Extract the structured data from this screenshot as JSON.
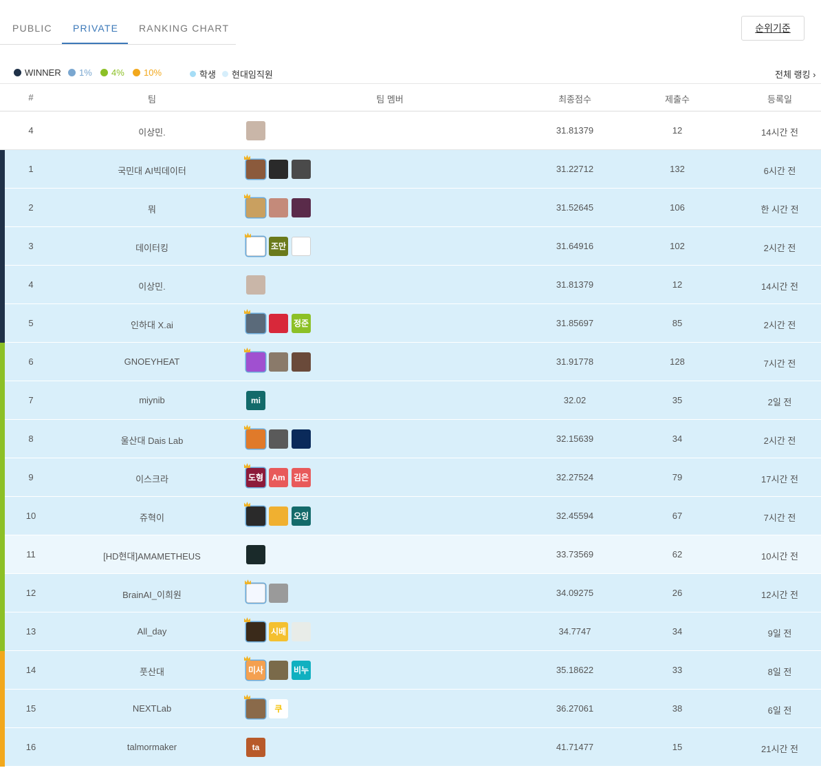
{
  "tabs": [
    {
      "label": "PUBLIC",
      "active": false
    },
    {
      "label": "PRIVATE",
      "active": true
    },
    {
      "label": "RANKING CHART",
      "active": false
    }
  ],
  "sort_button": "순위기준",
  "legend": [
    {
      "label": "WINNER",
      "color": "#1f3148"
    },
    {
      "label": "1%",
      "color": "#7aa7d0"
    },
    {
      "label": "4%",
      "color": "#8cc026"
    },
    {
      "label": "10%",
      "color": "#f2a81d"
    },
    {
      "label": "학생",
      "color": "#a6ddf6"
    },
    {
      "label": "현대임직원",
      "color": "#d6eefb"
    }
  ],
  "full_ranking_link": "전체 랭킹 ›",
  "columns": [
    "#",
    "팀",
    "팀 멤버",
    "최종점수",
    "제출수",
    "등록일"
  ],
  "rows": [
    {
      "rank": "4",
      "team": "이상민.",
      "score": "31.81379",
      "submissions": "12",
      "date": "14시간 전",
      "style": "white",
      "bar": "",
      "members": [
        {
          "type": "photo",
          "color": "#c9b6a8"
        }
      ]
    },
    {
      "rank": "1",
      "team": "국민대 AI빅데이터",
      "score": "31.22712",
      "submissions": "132",
      "date": "6시간 전",
      "style": "blue",
      "bar": "#1f3148",
      "members": [
        {
          "type": "photo",
          "color": "#8b5a3c",
          "leader": true
        },
        {
          "type": "photo",
          "color": "#2a2a2a"
        },
        {
          "type": "photo",
          "color": "#4a4a4a"
        }
      ]
    },
    {
      "rank": "2",
      "team": "뭐",
      "score": "31.52645",
      "submissions": "106",
      "date": "한 시간 전",
      "style": "blue",
      "bar": "#1f3148",
      "members": [
        {
          "type": "photo",
          "color": "#c9a060",
          "leader": true
        },
        {
          "type": "photo",
          "color": "#c48a7a"
        },
        {
          "type": "photo",
          "color": "#5a2b4a"
        }
      ]
    },
    {
      "rank": "3",
      "team": "데이터킹",
      "score": "31.64916",
      "submissions": "102",
      "date": "2시간 전",
      "style": "blue",
      "bar": "#1f3148",
      "members": [
        {
          "type": "photo",
          "color": "#ffffff",
          "leader": true
        },
        {
          "type": "text",
          "text": "조만",
          "color": "#6b7a1b"
        },
        {
          "type": "photo",
          "color": "#ffffff"
        }
      ]
    },
    {
      "rank": "4",
      "team": "이상민.",
      "score": "31.81379",
      "submissions": "12",
      "date": "14시간 전",
      "style": "blue",
      "bar": "#1f3148",
      "members": [
        {
          "type": "photo",
          "color": "#c9b6a8"
        }
      ]
    },
    {
      "rank": "5",
      "team": "인하대 X.ai",
      "score": "31.85697",
      "submissions": "85",
      "date": "2시간 전",
      "style": "blue",
      "bar": "#1f3148",
      "members": [
        {
          "type": "photo",
          "color": "#5a6a7a",
          "leader": true
        },
        {
          "type": "photo",
          "color": "#d8283a"
        },
        {
          "type": "text",
          "text": "정준",
          "color": "#8cc026"
        }
      ]
    },
    {
      "rank": "6",
      "team": "GNOEYHEAT",
      "score": "31.91778",
      "submissions": "128",
      "date": "7시간 전",
      "style": "blue",
      "bar": "#8cc026",
      "members": [
        {
          "type": "photo",
          "color": "#a050d0",
          "leader": true
        },
        {
          "type": "photo",
          "color": "#8a7a6a"
        },
        {
          "type": "photo",
          "color": "#6a4a3a"
        }
      ]
    },
    {
      "rank": "7",
      "team": "miynib",
      "score": "32.02",
      "submissions": "35",
      "date": "2일 전",
      "style": "blue",
      "bar": "#8cc026",
      "members": [
        {
          "type": "text",
          "text": "mi",
          "color": "#136a6a"
        }
      ]
    },
    {
      "rank": "8",
      "team": "울산대 Dais Lab",
      "score": "32.15639",
      "submissions": "34",
      "date": "2시간 전",
      "style": "blue",
      "bar": "#8cc026",
      "members": [
        {
          "type": "photo",
          "color": "#e07a2a",
          "leader": true
        },
        {
          "type": "photo",
          "color": "#5a5a5a"
        },
        {
          "type": "photo",
          "color": "#0a2a5a"
        }
      ]
    },
    {
      "rank": "9",
      "team": "이스크라",
      "score": "32.27524",
      "submissions": "79",
      "date": "17시간 전",
      "style": "blue",
      "bar": "#8cc026",
      "members": [
        {
          "type": "text",
          "text": "도형",
          "color": "#8c1a3a",
          "leader": true
        },
        {
          "type": "text",
          "text": "Am",
          "color": "#e85a5a"
        },
        {
          "type": "text",
          "text": "김은",
          "color": "#e85a5a"
        }
      ]
    },
    {
      "rank": "10",
      "team": "쥬혁이",
      "score": "32.45594",
      "submissions": "67",
      "date": "7시간 전",
      "style": "blue",
      "bar": "#8cc026",
      "members": [
        {
          "type": "photo",
          "color": "#2a2a2a",
          "leader": true
        },
        {
          "type": "photo",
          "color": "#f0b030"
        },
        {
          "type": "text",
          "text": "오잉",
          "color": "#136a6a"
        }
      ]
    },
    {
      "rank": "11",
      "team": "[HD현대]AMAMETHEUS",
      "score": "33.73569",
      "submissions": "62",
      "date": "10시간 전",
      "style": "light",
      "bar": "#8cc026",
      "members": [
        {
          "type": "photo",
          "color": "#1a2a2a"
        }
      ]
    },
    {
      "rank": "12",
      "team": "BrainAI_이희원",
      "score": "34.09275",
      "submissions": "26",
      "date": "12시간 전",
      "style": "blue",
      "bar": "#8cc026",
      "members": [
        {
          "type": "photo",
          "color": "#f4f8ff",
          "leader": true
        },
        {
          "type": "photo",
          "color": "#9a9a9a"
        }
      ]
    },
    {
      "rank": "13",
      "team": "All_day",
      "score": "34.7747",
      "submissions": "34",
      "date": "9일 전",
      "style": "blue",
      "bar": "#8cc026",
      "members": [
        {
          "type": "photo",
          "color": "#3a2a1a",
          "leader": true
        },
        {
          "type": "text",
          "text": "시베",
          "color": "#f4c030"
        },
        {
          "type": "photo",
          "color": "#e8ece8"
        }
      ]
    },
    {
      "rank": "14",
      "team": "풋산대",
      "score": "35.18622",
      "submissions": "33",
      "date": "8일 전",
      "style": "blue",
      "bar": "#f2a81d",
      "members": [
        {
          "type": "text",
          "text": "미사",
          "color": "#f4a050",
          "leader": true
        },
        {
          "type": "photo",
          "color": "#7a6a4a"
        },
        {
          "type": "text",
          "text": "비누",
          "color": "#10b0c0"
        }
      ]
    },
    {
      "rank": "15",
      "team": "NEXTLab",
      "score": "36.27061",
      "submissions": "38",
      "date": "6일 전",
      "style": "blue",
      "bar": "#f2a81d",
      "members": [
        {
          "type": "photo",
          "color": "#8a6a4a",
          "leader": true
        },
        {
          "type": "text",
          "text": "쿠",
          "color": "#ffffff"
        }
      ]
    },
    {
      "rank": "16",
      "team": "talmormaker",
      "score": "41.71477",
      "submissions": "15",
      "date": "21시간 전",
      "style": "blue",
      "bar": "#f2a81d",
      "members": [
        {
          "type": "text",
          "text": "ta",
          "color": "#b85a2a"
        }
      ]
    }
  ]
}
